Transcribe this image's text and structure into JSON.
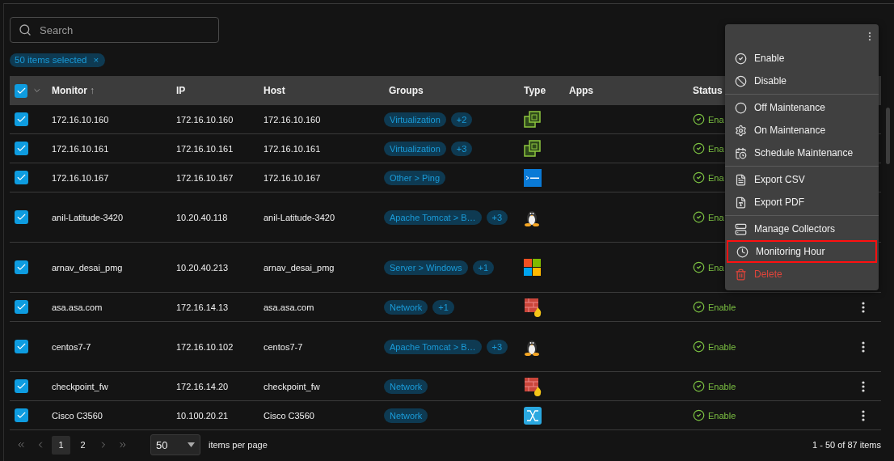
{
  "search": {
    "placeholder": "Search"
  },
  "selection_chip": {
    "label": "50 items selected",
    "close": "×"
  },
  "table": {
    "header_checked": true,
    "columns": [
      {
        "label": "Monitor",
        "sort": "↑"
      },
      {
        "label": "IP"
      },
      {
        "label": "Host"
      },
      {
        "label": "Groups"
      },
      {
        "label": "Type"
      },
      {
        "label": "Apps"
      },
      {
        "label": "Status"
      }
    ],
    "rows": [
      {
        "checked": true,
        "monitor": "172.16.10.160",
        "ip": "172.16.10.160",
        "host": "172.16.10.160",
        "groups": [
          "Virtualization",
          "+2"
        ],
        "kind": "vmware",
        "status": "Ena",
        "actions": false
      },
      {
        "checked": true,
        "monitor": "172.16.10.161",
        "ip": "172.16.10.161",
        "host": "172.16.10.161",
        "groups": [
          "Virtualization",
          "+3"
        ],
        "kind": "vmware",
        "status": "Ena",
        "actions": false
      },
      {
        "checked": true,
        "monitor": "172.16.10.167",
        "ip": "172.16.10.167",
        "host": "172.16.10.167",
        "groups": [
          "Other > Ping"
        ],
        "kind": "ping",
        "status": "Ena",
        "actions": false
      },
      {
        "checked": true,
        "monitor": "anil-Latitude-3420",
        "ip": "10.20.40.118",
        "host": "anil-Latitude-3420",
        "groups": [
          "Apache Tomcat > B…",
          "+3"
        ],
        "kind": "linux",
        "status": "Ena",
        "actions": false
      },
      {
        "checked": true,
        "monitor": "arnav_desai_pmg",
        "ip": "10.20.40.213",
        "host": "arnav_desai_pmg",
        "groups": [
          "Server > Windows",
          "+1"
        ],
        "kind": "windows",
        "status": "Ena",
        "actions": false
      },
      {
        "checked": true,
        "monitor": "asa.asa.com",
        "ip": "172.16.14.13",
        "host": "asa.asa.com",
        "groups": [
          "Network",
          "+1"
        ],
        "kind": "firewall",
        "status": "Enable",
        "actions": true
      },
      {
        "checked": true,
        "monitor": "centos7-7",
        "ip": "172.16.10.102",
        "host": "centos7-7",
        "groups": [
          "Apache Tomcat > B…",
          "+3"
        ],
        "kind": "linux",
        "status": "Enable",
        "actions": true
      },
      {
        "checked": true,
        "monitor": "checkpoint_fw",
        "ip": "172.16.14.20",
        "host": "checkpoint_fw",
        "groups": [
          "Network"
        ],
        "kind": "firewall",
        "status": "Enable",
        "actions": true
      },
      {
        "checked": true,
        "monitor": "Cisco C3560",
        "ip": "10.100.20.21",
        "host": "Cisco C3560",
        "groups": [
          "Network"
        ],
        "kind": "switch",
        "status": "Enable",
        "actions": true
      }
    ]
  },
  "pagination": {
    "pages": [
      {
        "label": "1",
        "selected": true
      },
      {
        "label": "2",
        "selected": false
      }
    ],
    "page_size": "50",
    "page_size_label": "items per page",
    "summary": "1 - 50 of 87 items"
  },
  "context_menu": {
    "sections": [
      [
        {
          "label": "Enable",
          "kind": "normal",
          "highlighted": false
        },
        {
          "label": "Disable",
          "kind": "normal",
          "highlighted": false
        }
      ],
      [
        {
          "label": "Off Maintenance",
          "kind": "normal",
          "highlighted": false
        },
        {
          "label": "On Maintenance",
          "kind": "normal",
          "highlighted": false
        },
        {
          "label": "Schedule Maintenance",
          "kind": "normal",
          "highlighted": false
        }
      ],
      [
        {
          "label": "Export CSV",
          "kind": "normal",
          "highlighted": false
        },
        {
          "label": "Export PDF",
          "kind": "normal",
          "highlighted": false
        }
      ],
      [
        {
          "label": "Manage Collectors",
          "kind": "normal",
          "highlighted": false
        },
        {
          "label": "Monitoring Hour",
          "kind": "normal",
          "highlighted": true
        },
        {
          "label": "Delete",
          "kind": "danger",
          "highlighted": false
        }
      ]
    ]
  }
}
